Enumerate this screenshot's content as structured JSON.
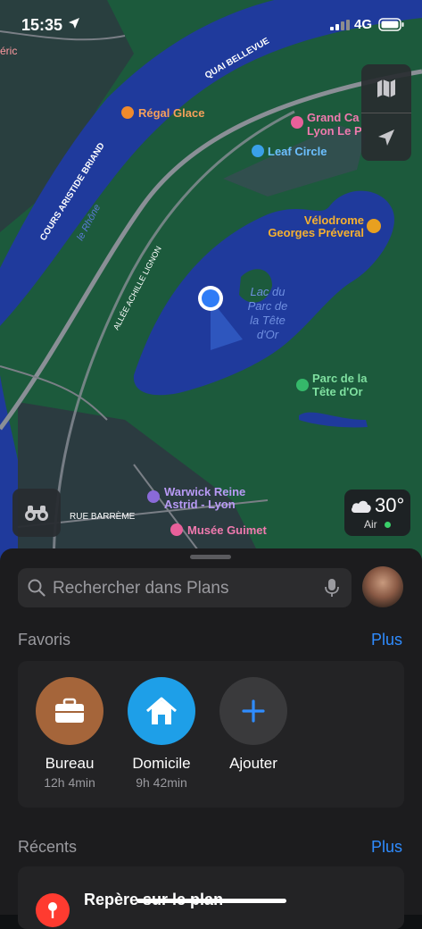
{
  "status_bar": {
    "time": "15:35",
    "network": "4G"
  },
  "map": {
    "labels": {
      "eric": "éric",
      "quai": "QUAI BELLEVUE",
      "cours": "COURS ARISTIDE BRIAND",
      "rhone": "le Rhône",
      "allee": "ALLÉE ACHILLE LIGNON",
      "rue": "RUE BARRÈME",
      "lac": [
        "Lac du",
        "Parc de",
        "la Tête",
        "d'Or"
      ]
    },
    "pois": {
      "regal": "Régal Glace",
      "grand_casino": [
        "Grand Ca",
        "Lyon Le P"
      ],
      "leaf": "Leaf Circle",
      "velodrome": [
        "Vélodrome",
        "Georges Préveral"
      ],
      "parc": [
        "Parc de la",
        "Tête d'Or"
      ],
      "warwick": [
        "Warwick Reine",
        "Astrid - Lyon"
      ],
      "guimet": "Musée Guimet"
    },
    "colors": {
      "land": "#1c5a3c",
      "water": "#1f3a9c",
      "road": "#8a8f96"
    }
  },
  "weather": {
    "temp": "30°",
    "air_label": "Air"
  },
  "sheet": {
    "search_placeholder": "Rechercher dans Plans",
    "favorites_title": "Favoris",
    "favorites_more": "Plus",
    "favorites": [
      {
        "label": "Bureau",
        "subtitle": "12h 4min",
        "icon": "briefcase-icon",
        "color": "#a5653a"
      },
      {
        "label": "Domicile",
        "subtitle": "9h 42min",
        "icon": "house-icon",
        "color": "#1e9fe8"
      },
      {
        "label": "Ajouter",
        "subtitle": "",
        "icon": "plus-icon",
        "color": "#3a3a3c"
      }
    ],
    "recents_title": "Récents",
    "recents_more": "Plus",
    "recents": [
      {
        "title": "Repère sur le plan",
        "icon": "pin-icon"
      }
    ]
  }
}
